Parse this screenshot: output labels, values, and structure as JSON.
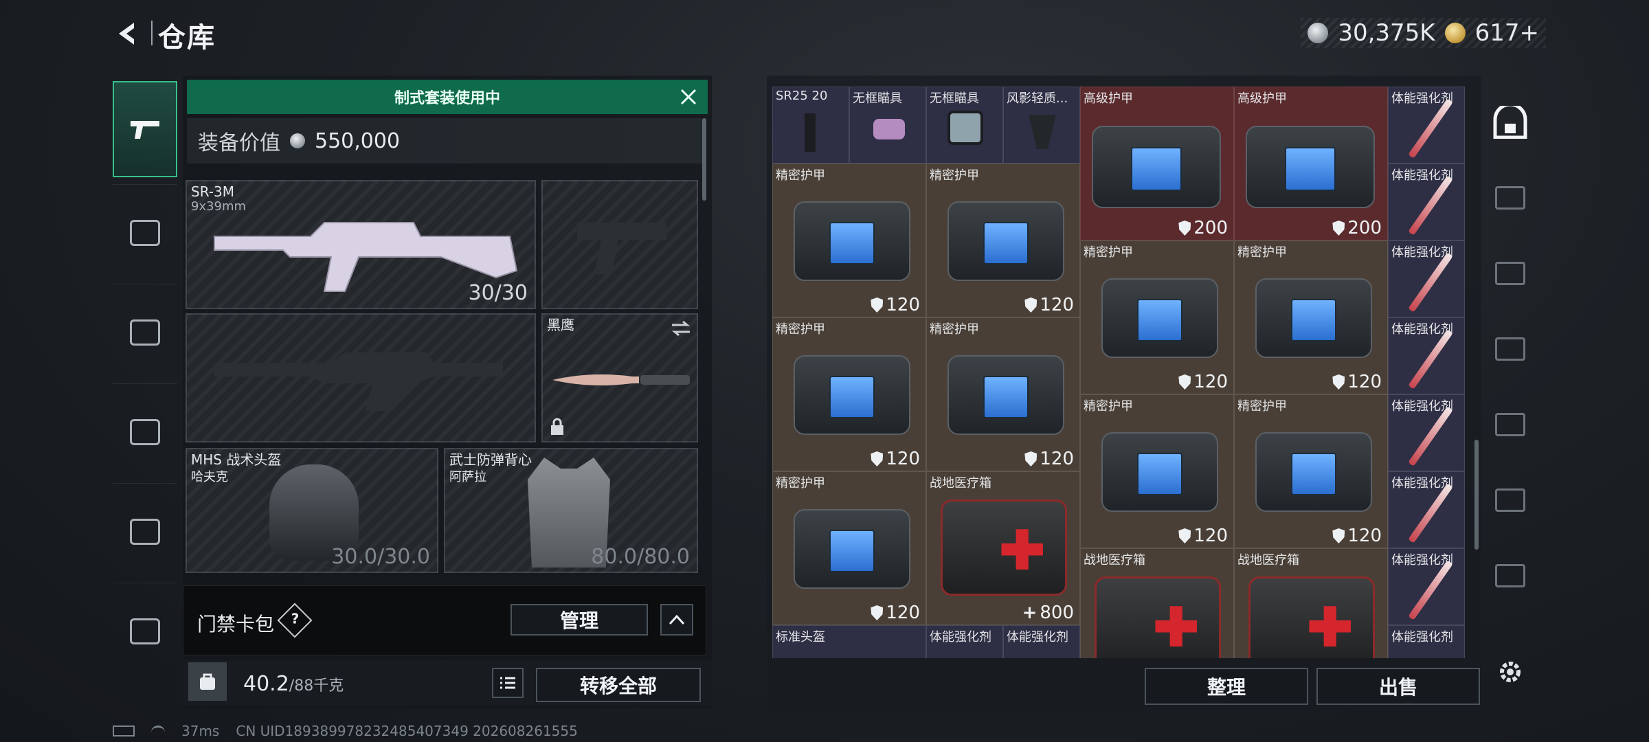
{
  "header": {
    "title": "仓库",
    "currency_silver": "30,375K",
    "currency_gold": "617+"
  },
  "left_nav": {
    "items": [
      "gun-icon",
      "armor-icon",
      "backpack-icon",
      "vest-icon",
      "locker-icon",
      "briefcase-icon"
    ]
  },
  "loadout": {
    "banner": "制式套装使用中",
    "value_label": "装备价值",
    "value": "550,000",
    "primary": {
      "name": "SR-3M",
      "ammo": "9x39mm",
      "count": "30/30"
    },
    "melee": {
      "name": "黑鹰"
    },
    "helmet": {
      "name": "MHS 战术头盔",
      "maker": "哈夫克",
      "durability": "30.0/30.0"
    },
    "vest": {
      "name": "武士防弹背心",
      "maker": "阿萨拉",
      "durability": "80.0/80.0"
    },
    "keycard_label": "门禁卡包",
    "keycard_help": "?",
    "manage_label": "管理",
    "weight": "40.2",
    "weight_max": "/88千克",
    "transfer_label": "转移全部"
  },
  "stash": {
    "top_row": [
      "SR25 20",
      "无框瞄具",
      "无框瞄具",
      "风影轻质..."
    ],
    "high_armor_label": "高级护甲",
    "high_armor_value": "200",
    "precision_armor_label": "精密护甲",
    "precision_armor_value": "120",
    "medkit_label": "战地医疗箱",
    "medkit_value": "800",
    "stim_label": "体能强化剂",
    "helmet_label": "标准头盔",
    "sort_label": "整理",
    "sell_label": "出售"
  },
  "status_bar": {
    "ping": "37ms",
    "uid": "CN UID189389978232485407349 202608261555"
  },
  "colors": {
    "accent_green": "#0f6b4b",
    "highlight": "#35c08b"
  }
}
